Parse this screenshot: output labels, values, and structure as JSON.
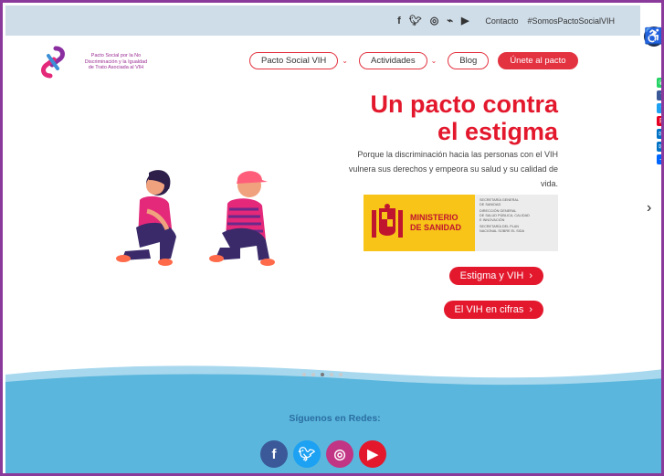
{
  "topbar": {
    "social_icons": [
      "facebook-icon",
      "twitter-icon",
      "instagram-icon",
      "rss-icon",
      "youtube-icon"
    ],
    "social_glyphs": [
      "f",
      "🐦",
      "◎",
      "⌁",
      "▶"
    ],
    "contact": "Contacto",
    "hashtag": "#SomosPactoSocialVIH"
  },
  "logo": {
    "text_line1": "Pacto Social por la No",
    "text_line2": "Discriminación y la Igualdad",
    "text_line3": "de Trato Asociada al VIH"
  },
  "nav": {
    "items": [
      {
        "label": "Pacto Social VIH",
        "has_dropdown": true
      },
      {
        "label": "Actividades",
        "has_dropdown": true
      },
      {
        "label": "Blog",
        "has_dropdown": false
      },
      {
        "label": "Únete al pacto",
        "has_dropdown": false
      }
    ]
  },
  "hero": {
    "title_line1": "Un pacto contra",
    "title_line2": "el estigma",
    "subtitle": "Porque la discriminación hacia las personas con el VIH vulnera sus derechos y empeora su salud y su calidad de vida.",
    "ministry": {
      "name_line1": "MINISTERIO",
      "name_line2": "DE SANIDAD",
      "right_lines": [
        "SECRETARÍA GENERAL",
        "DE SANIDAD",
        "DIRECCIÓN GENERAL",
        "DE SALUD PÚBLICA, CALIDAD",
        "E INNOVACIÓN",
        "SECRETARÍA DEL PLAN",
        "NACIONAL SOBRE EL SIDA"
      ]
    },
    "cta1": "Estigma y VIH",
    "cta2": "El VIH en cifras",
    "slide_count": 5,
    "active_slide": 3
  },
  "footer": {
    "title": "Síguenos en Redes:",
    "icons": [
      "facebook-icon",
      "twitter-icon",
      "instagram-icon",
      "youtube-icon"
    ]
  },
  "share_bar": {
    "icons": [
      "whatsapp-icon",
      "facebook-icon",
      "twitter-icon",
      "pinterest-icon",
      "email-icon",
      "email-alt-icon",
      "plus-icon"
    ]
  },
  "colors": {
    "brand_red": "#e3182d",
    "topbar_bg": "#cfdde8",
    "footer_blue": "#5ab6dc",
    "logo_purple": "#9a2b92"
  }
}
